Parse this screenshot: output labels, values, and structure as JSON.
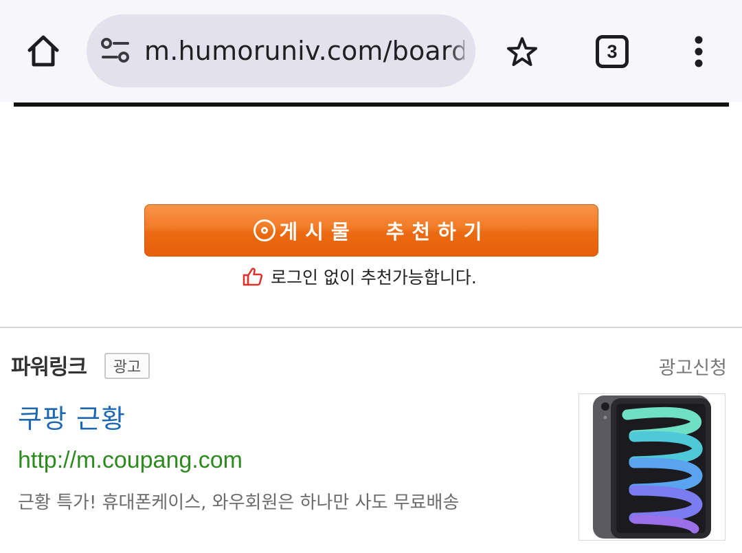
{
  "browser": {
    "url": "m.humoruniv.com/board",
    "tab_count": "3",
    "icons": {
      "home": "home-icon",
      "site_settings": "tune-icon",
      "bookmark": "star-icon",
      "tabs": "tab-switcher-icon",
      "menu": "more-vert-icon"
    }
  },
  "recommend": {
    "button_label": "게시물  추천하기",
    "note": "로그인 없이 추천가능합니다.",
    "button_color": "#ea6a12"
  },
  "powerlink": {
    "title": "파워링크",
    "badge": "광고",
    "apply_link": "광고신청",
    "ad": {
      "title": "쿠팡 근황",
      "url": "http://m.coupang.com",
      "description": "근황 특가! 휴대폰케이스, 와우회원은 하나만 사도 무료배송",
      "image": "tablet-product-image"
    },
    "colors": {
      "title": "#1e67b2",
      "url": "#2c8a1f"
    }
  }
}
